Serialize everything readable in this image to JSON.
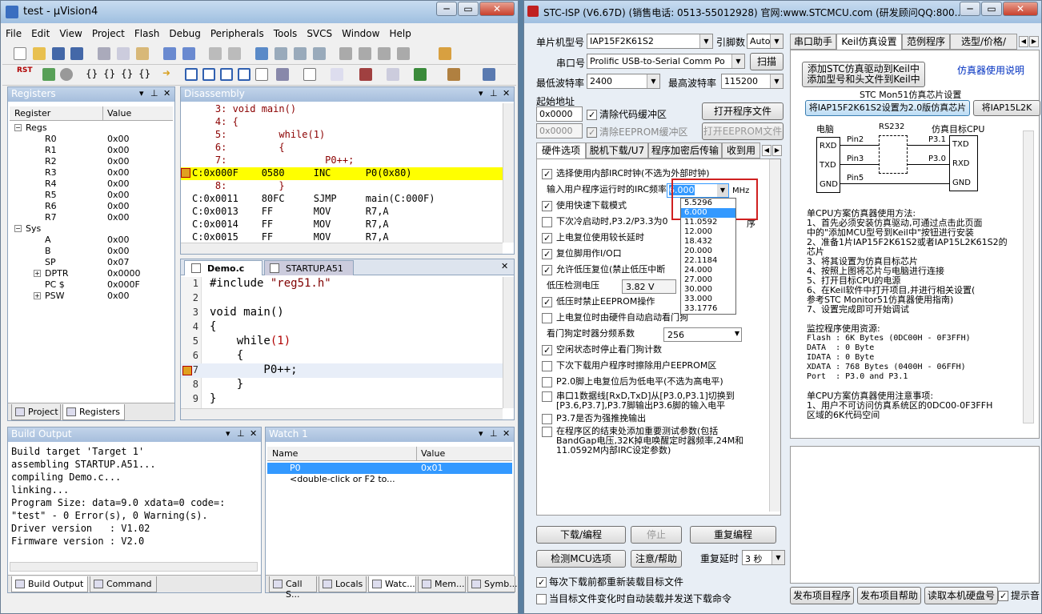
{
  "uv": {
    "title": "test  - µVision4",
    "menu": [
      "File",
      "Edit",
      "View",
      "Project",
      "Flash",
      "Debug",
      "Peripherals",
      "Tools",
      "SVCS",
      "Window",
      "Help"
    ],
    "rst_label": "RST",
    "registers": {
      "title": "Registers",
      "col_register": "Register",
      "col_value": "Value",
      "rows": [
        {
          "name": "Regs",
          "value": "",
          "indent": 0,
          "expander": "−"
        },
        {
          "name": "R0",
          "value": "0x00",
          "indent": 2,
          "expander": ""
        },
        {
          "name": "R1",
          "value": "0x00",
          "indent": 2,
          "expander": ""
        },
        {
          "name": "R2",
          "value": "0x00",
          "indent": 2,
          "expander": ""
        },
        {
          "name": "R3",
          "value": "0x00",
          "indent": 2,
          "expander": ""
        },
        {
          "name": "R4",
          "value": "0x00",
          "indent": 2,
          "expander": ""
        },
        {
          "name": "R5",
          "value": "0x00",
          "indent": 2,
          "expander": ""
        },
        {
          "name": "R6",
          "value": "0x00",
          "indent": 2,
          "expander": ""
        },
        {
          "name": "R7",
          "value": "0x00",
          "indent": 2,
          "expander": ""
        },
        {
          "name": "Sys",
          "value": "",
          "indent": 0,
          "expander": "−"
        },
        {
          "name": "A",
          "value": "0x00",
          "indent": 2,
          "expander": ""
        },
        {
          "name": "B",
          "value": "0x00",
          "indent": 2,
          "expander": ""
        },
        {
          "name": "SP",
          "value": "0x07",
          "indent": 2,
          "expander": ""
        },
        {
          "name": "DPTR",
          "value": "0x0000",
          "indent": 2,
          "expander": "+"
        },
        {
          "name": "PC  $",
          "value": "0x000F",
          "indent": 2,
          "expander": ""
        },
        {
          "name": "PSW",
          "value": "0x00",
          "indent": 2,
          "expander": "+"
        }
      ],
      "tab_project": "Project",
      "tab_registers": "Registers"
    },
    "disassembly": {
      "title": "Disassembly",
      "lines": [
        {
          "text": "    3: void main()",
          "color": "#8b0000",
          "hl": false
        },
        {
          "text": "    4: {",
          "color": "#8b0000",
          "hl": false
        },
        {
          "text": "    5:         while(1)",
          "color": "#8b0000",
          "hl": false
        },
        {
          "text": "    6:         {",
          "color": "#8b0000",
          "hl": false
        },
        {
          "text": "    7:                 P0++;",
          "color": "#8b0000",
          "hl": false
        },
        {
          "text": "C:0x000F    0580     INC      P0(0x80)",
          "color": "#000",
          "hl": true
        },
        {
          "text": "    8:         }",
          "color": "#8b0000",
          "hl": false
        },
        {
          "text": "C:0x0011    80FC     SJMP     main(C:000F)",
          "color": "#000",
          "hl": false
        },
        {
          "text": "C:0x0013    FF       MOV      R7,A",
          "color": "#000",
          "hl": false
        },
        {
          "text": "C:0x0014    FF       MOV      R7,A",
          "color": "#000",
          "hl": false
        },
        {
          "text": "C:0x0015    FF       MOV      R7,A",
          "color": "#000",
          "hl": false
        }
      ]
    },
    "editor": {
      "tab1": "Demo.c",
      "tab2": "STARTUP.A51",
      "lines": [
        {
          "num": "1",
          "text": "#include \"reg51.h\""
        },
        {
          "num": "2",
          "text": ""
        },
        {
          "num": "3",
          "text": "void main()"
        },
        {
          "num": "4",
          "text": "{"
        },
        {
          "num": "5",
          "text": "    while(1)"
        },
        {
          "num": "6",
          "text": "    {"
        },
        {
          "num": "7",
          "text": "        P0++;"
        },
        {
          "num": "8",
          "text": "    }"
        },
        {
          "num": "9",
          "text": "}"
        }
      ]
    },
    "build": {
      "title": "Build Output",
      "lines": [
        "Build target 'Target 1'",
        "assembling STARTUP.A51...",
        "compiling Demo.c...",
        "linking...",
        "Program Size: data=9.0 xdata=0 code=:",
        "\"test\" - 0 Error(s), 0 Warning(s).",
        "Driver version   : V1.02",
        "Firmware version : V2.0"
      ],
      "tab_build": "Build Output",
      "tab_command": "Command"
    },
    "watch": {
      "title": "Watch 1",
      "col_name": "Name",
      "col_value": "Value",
      "rows": [
        {
          "name": "P0",
          "value": "0x01"
        },
        {
          "name": "<double-click or F2 to...",
          "value": ""
        }
      ],
      "tabs": [
        "Call S...",
        "Locals",
        "Watc...",
        "Mem...",
        "Symb..."
      ]
    }
  },
  "stc": {
    "title": "STC-ISP (V6.67D) (销售电话: 0513-55012928) 官网:www.STCMCU.com  (研发顾问QQ:800...",
    "mcu_label": "单片机型号",
    "mcu_value": "IAP15F2K61S2",
    "pins_label": "引脚数",
    "pins_value": "Auto",
    "port_label": "串口号",
    "port_value": "Prolific USB-to-Serial Comm Po",
    "scan_btn": "扫描",
    "minbaud_label": "最低波特率",
    "minbaud_value": "2400",
    "maxbaud_label": "最高波特率",
    "maxbaud_value": "115200",
    "start_addr_label": "起始地址",
    "addr1": "0x0000",
    "clear_code": "清除代码缓冲区",
    "open_prog": "打开程序文件",
    "addr2": "0x0000",
    "clear_eeprom": "清除EEPROM缓冲区",
    "open_eeprom": "打开EEPROM文件",
    "hw_tabs": [
      "硬件选项",
      "脱机下载/U7",
      "程序加密后传输",
      "收到用"
    ],
    "options": [
      {
        "text": "选择使用内部IRC时钟(不选为外部时钟)",
        "checked": true
      },
      {
        "text": "输入用户程序运行时的IRC频率",
        "checked": null
      },
      {
        "text": "使用快速下载模式",
        "checked": true
      },
      {
        "text": "下次冷启动时,P3.2/P3.3为0",
        "checked": false
      },
      {
        "text": "上电复位使用较长延时",
        "checked": true
      },
      {
        "text": "复位脚用作I/O口",
        "checked": true
      },
      {
        "text": "允许低压复位(禁止低压中断",
        "checked": true
      },
      {
        "text": "低压检测电压",
        "checked": null
      },
      {
        "text": "低压时禁止EEPROM操作",
        "checked": true
      },
      {
        "text": "上电复位时由硬件自动启动看门狗",
        "checked": false
      },
      {
        "text": "看门狗定时器分频系数",
        "checked": null
      },
      {
        "text": "空闲状态时停止看门狗计数",
        "checked": true
      },
      {
        "text": "下次下载用户程序时擦除用户EEPROM区",
        "checked": false
      },
      {
        "text": "P2.0脚上电复位后为低电平(不选为高电平)",
        "checked": false
      },
      {
        "text": "串口1数据线[RxD,TxD]从[P3.0,P3.1]切换到\n[P3.6,P3.7],P3.7脚输出P3.6脚的输入电平",
        "checked": false
      },
      {
        "text": "P3.7是否为强推挽输出",
        "checked": false
      },
      {
        "text": "在程序区的结束处添加重要测试参数(包括\nBandGap电压,32K掉电唤醒定时器频率,24M和\n11.0592M内部IRC设定参数)",
        "checked": false
      }
    ],
    "cold_suffix": "序",
    "irc_value": "6.000",
    "irc_unit": "MHz",
    "lowv_value": "3.82 V",
    "wdt_value": "256",
    "freq_options": [
      "5.5296",
      "6.000",
      "11.0592",
      "12.000",
      "18.432",
      "20.000",
      "22.1184",
      "24.000",
      "27.000",
      "30.000",
      "33.000",
      "33.1776"
    ],
    "freq_selected": 1,
    "btn_download": "下载/编程",
    "btn_stop": "停止",
    "btn_reprogram": "重复编程",
    "btn_detect": "检测MCU选项",
    "btn_help": "注意/帮助",
    "repeat_delay_label": "重复延时",
    "repeat_delay_value": "3 秒",
    "reload_check": "每次下载前都重新装载目标文件",
    "auto_check": "当目标文件变化时自动装载并发送下载命令",
    "right_tabs": [
      "串口助手",
      "Keil仿真设置",
      "范例程序",
      "选型/价格/"
    ],
    "add_keil_btn": "添加STC仿真驱动到Keil中\n添加型号和头文件到Keil中",
    "sim_help": "仿真器使用说明",
    "mon51_title": "STC Mon51仿真芯片设置",
    "set_btn1": "将IAP15F2K61S2设置为2.0版仿真芯片",
    "set_btn2": "将IAP15L2K",
    "diagram": {
      "pc": "电脑",
      "rs232": "RS232",
      "cpu": "仿真目标CPU",
      "rxd": "RXD",
      "txd": "TXD",
      "gnd": "GND",
      "pin2": "Pin2",
      "pin3": "Pin3",
      "pin5": "Pin5",
      "p31": "P3.1",
      "p30": "P3.0"
    },
    "info_lines": [
      "单CPU方案仿真器使用方法:",
      "1、首先必须安装仿真驱动,可通过点击此页面",
      "中的\"添加MCU型号到Keil中\"按钮进行安装",
      "2、准备1片IAP15F2K61S2或者IAP15L2K61S2的",
      "芯片",
      "3、将其设置为仿真目标芯片",
      "4、按照上图将芯片与电脑进行连接",
      "5、打开目标CPU的电源",
      "6、在Keil软件中打开项目,并进行相关设置(",
      "参考STC Monitor51仿真器使用指南)",
      "7、设置完成即可开始调试",
      "",
      "监控程序使用资源:",
      "Flash : 6K Bytes (0DC00H - 0F3FFH)",
      "DATA  : 0 Byte",
      "IDATA : 0 Byte",
      "XDATA : 768 Bytes (0400H - 06FFH)",
      "Port  : P3.0 and P3.1",
      "",
      "单CPU方案仿真器使用注意事项:",
      "1、用户不可访问仿真系统区的0DC00-0F3FFH",
      "区域的6K代码空间"
    ],
    "bottom_btns": [
      "发布项目程序",
      "发布项目帮助",
      "读取本机硬盘号"
    ],
    "tip_check": "提示音"
  }
}
